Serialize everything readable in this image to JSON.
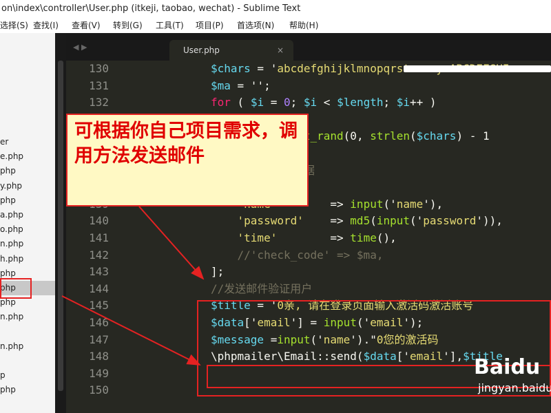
{
  "window": {
    "title": "on\\index\\controller\\User.php (itkeji, taobao, wechat) - Sublime Text"
  },
  "menu": [
    "选择(S)",
    "查找(I)",
    "查看(V)",
    "转到(G)",
    "工具(T)",
    "项目(P)",
    "首选项(N)",
    "帮助(H)"
  ],
  "sidebar": {
    "files": [
      "er",
      "e.php",
      "php",
      "y.php",
      "php",
      "a.php",
      "o.php",
      "n.php",
      "h.php",
      "php",
      "php",
      "php",
      "n.php",
      "",
      "n.php",
      "",
      "p",
      "php"
    ],
    "selected_index": 10
  },
  "tab": {
    "label": "User.php",
    "nav": "◀ ▶",
    "close": "×"
  },
  "editor": {
    "lines": [
      {
        "num": "130",
        "tokens": [
          {
            "t": "$chars",
            "c": "v"
          },
          {
            "t": " = '",
            "c": "p"
          },
          {
            "t": "abcdefghijklmnopqrstuvwxyzABCDEFGHI",
            "c": "s"
          }
        ]
      },
      {
        "num": "131",
        "tokens": [
          {
            "t": "$ma",
            "c": "v"
          },
          {
            "t": " = '';",
            "c": "p"
          }
        ]
      },
      {
        "num": "132",
        "tokens": [
          {
            "t": "for",
            "c": "k"
          },
          {
            "t": " ( ",
            "c": "p"
          },
          {
            "t": "$i",
            "c": "v"
          },
          {
            "t": " = ",
            "c": "p"
          },
          {
            "t": "0",
            "c": "n"
          },
          {
            "t": "; ",
            "c": "p"
          },
          {
            "t": "$i",
            "c": "v"
          },
          {
            "t": " < ",
            "c": "p"
          },
          {
            "t": "$length",
            "c": "v"
          },
          {
            "t": "; ",
            "c": "p"
          },
          {
            "t": "$i",
            "c": "v"
          },
          {
            "t": "++ )",
            "c": "p"
          }
        ]
      },
      {
        "num": "",
        "tokens": []
      },
      {
        "num": "",
        "tokens": [
          {
            "t": "           [ ",
            "c": "p"
          },
          {
            "t": "mt_rand",
            "c": "f"
          },
          {
            "t": "(0, ",
            "c": "p"
          },
          {
            "t": "strlen",
            "c": "f"
          },
          {
            "t": "(",
            "c": "p"
          },
          {
            "t": "$chars",
            "c": "v"
          },
          {
            "t": ") - 1",
            "c": "p"
          }
        ]
      },
      {
        "num": "",
        "tokens": []
      },
      {
        "num": "",
        "tokens": [
          {
            "t": "              据",
            "c": "c"
          }
        ]
      },
      {
        "num": "",
        "tokens": []
      },
      {
        "num": "139",
        "tokens": [
          {
            "t": "    'name'",
            "c": "s"
          },
          {
            "t": "        => ",
            "c": "p"
          },
          {
            "t": "input",
            "c": "f"
          },
          {
            "t": "('",
            "c": "p"
          },
          {
            "t": "name",
            "c": "s"
          },
          {
            "t": "'),",
            "c": "p"
          }
        ]
      },
      {
        "num": "140",
        "tokens": [
          {
            "t": "    'password'",
            "c": "s"
          },
          {
            "t": "    => ",
            "c": "p"
          },
          {
            "t": "md5",
            "c": "f"
          },
          {
            "t": "(",
            "c": "p"
          },
          {
            "t": "input",
            "c": "f"
          },
          {
            "t": "('",
            "c": "p"
          },
          {
            "t": "password",
            "c": "s"
          },
          {
            "t": "')),",
            "c": "p"
          }
        ]
      },
      {
        "num": "141",
        "tokens": [
          {
            "t": "    'time'",
            "c": "s"
          },
          {
            "t": "        => ",
            "c": "p"
          },
          {
            "t": "time",
            "c": "f"
          },
          {
            "t": "(),",
            "c": "p"
          }
        ]
      },
      {
        "num": "142",
        "tokens": [
          {
            "t": "    //'check_code' => $ma,",
            "c": "c"
          }
        ]
      },
      {
        "num": "143",
        "tokens": [
          {
            "t": "];",
            "c": "p"
          }
        ]
      },
      {
        "num": "144",
        "tokens": [
          {
            "t": "//发送邮件验证用户",
            "c": "c"
          }
        ]
      },
      {
        "num": "145",
        "tokens": [
          {
            "t": "$title",
            "c": "v"
          },
          {
            "t": " = '",
            "c": "p"
          },
          {
            "t": "0亲, 请在登录页面输入激活码激活账号",
            "c": "s"
          }
        ]
      },
      {
        "num": "146",
        "tokens": [
          {
            "t": "$data",
            "c": "v"
          },
          {
            "t": "['",
            "c": "p"
          },
          {
            "t": "email",
            "c": "s"
          },
          {
            "t": "'] = ",
            "c": "p"
          },
          {
            "t": "input",
            "c": "f"
          },
          {
            "t": "('",
            "c": "p"
          },
          {
            "t": "email",
            "c": "s"
          },
          {
            "t": "');",
            "c": "p"
          }
        ]
      },
      {
        "num": "147",
        "tokens": [
          {
            "t": "$message",
            "c": "v"
          },
          {
            "t": " =",
            "c": "p"
          },
          {
            "t": "input",
            "c": "f"
          },
          {
            "t": "('",
            "c": "p"
          },
          {
            "t": "name",
            "c": "s"
          },
          {
            "t": "').\"",
            "c": "p"
          },
          {
            "t": "0您的激活码",
            "c": "s"
          }
        ]
      },
      {
        "num": "148",
        "tokens": [
          {
            "t": "\\phpmailer\\Email::send(",
            "c": "p"
          },
          {
            "t": "$data",
            "c": "v"
          },
          {
            "t": "['",
            "c": "p"
          },
          {
            "t": "email",
            "c": "s"
          },
          {
            "t": "'],",
            "c": "p"
          },
          {
            "t": "$title",
            "c": "v"
          }
        ]
      },
      {
        "num": "149",
        "tokens": []
      },
      {
        "num": "150",
        "tokens": []
      }
    ]
  },
  "callout": {
    "text": "可根据你自己项目需求，调用方法发送邮件"
  },
  "watermark": {
    "logo": "Baidu",
    "sub": "jingyan.baidu"
  },
  "colors": {
    "annotation": "#e52222",
    "editor_bg": "#272822",
    "callout_bg": "#fff9c4"
  }
}
